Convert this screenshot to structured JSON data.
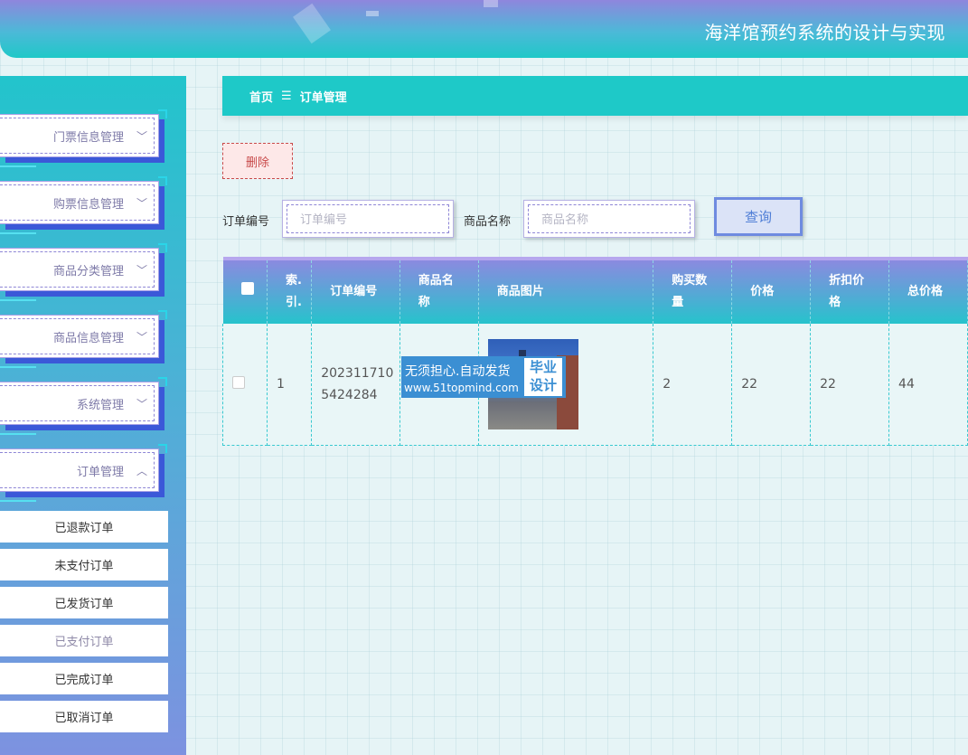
{
  "header": {
    "app_title": "海洋馆预约系统的设计与实现"
  },
  "sidebar": {
    "menus": [
      {
        "label": "门票信息管理",
        "chevron": "﹀"
      },
      {
        "label": "购票信息管理",
        "chevron": "﹀"
      },
      {
        "label": "商品分类管理",
        "chevron": "﹀"
      },
      {
        "label": "商品信息管理",
        "chevron": "﹀"
      },
      {
        "label": "系统管理",
        "chevron": "﹀"
      },
      {
        "label": "订单管理",
        "chevron": "︿"
      }
    ],
    "submenu": [
      {
        "label": "已退款订单"
      },
      {
        "label": "未支付订单"
      },
      {
        "label": "已发货订单"
      },
      {
        "label": "已支付订单",
        "active": true
      },
      {
        "label": "已完成订单"
      },
      {
        "label": "已取消订单"
      }
    ]
  },
  "breadcrumb": {
    "home": "首页",
    "separator": "☰",
    "current": "订单管理"
  },
  "toolbar": {
    "delete_label": "删除"
  },
  "search": {
    "order_label": "订单编号",
    "order_placeholder": "订单编号",
    "product_label": "商品名称",
    "product_placeholder": "商品名称",
    "query_label": "查询"
  },
  "table": {
    "headers": {
      "index": "索.\n引.",
      "order_no": "订单编号",
      "product_name": "商品名\n称",
      "product_image": "商品图片",
      "quantity": "购买数\n量",
      "price": "价格",
      "discount_price": "折扣价\n格",
      "total": "总价格"
    },
    "rows": [
      {
        "index": "1",
        "order_no": "202311710\n5424284",
        "product_name": "",
        "quantity": "2",
        "price": "22",
        "discount_price": "22",
        "total": "44"
      }
    ]
  },
  "watermark": {
    "line1": "无须担心.自动发货",
    "line2": "www.51topmind.com",
    "badge": "毕业\n设计"
  }
}
